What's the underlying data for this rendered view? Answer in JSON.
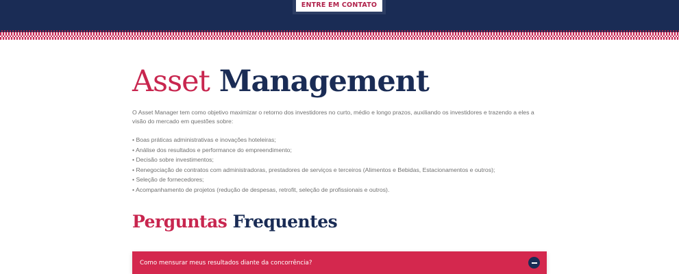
{
  "header": {
    "cta_label": "ENTRE EM CONTATO"
  },
  "main": {
    "title_light": "Asset",
    "title_bold": "Management",
    "intro": "O Asset Manager tem como objetivo maximizar o retorno dos investidores no curto, médio e longo prazos, auxiliando os investidores e trazendo a eles a visão do mercado em questões sobre:",
    "bullets": [
      "• Boas práticas administrativas e inovações hoteleiras;",
      "• Análise dos resultados e performance do empreendimento;",
      "• Decisão sobre investimentos;",
      "• Renegociação de contratos com administradoras, prestadores de serviços e terceiros (Alimentos e Bebidas, Estacionamentos e outros);",
      "• Seleção de fornecedores;",
      "• Acompanhamento de projetos (redução de despesas, retrofit, seleção de profissionais e outros)."
    ]
  },
  "faq": {
    "title_light": "Perguntas",
    "title_bold": "Frequentes",
    "items": [
      {
        "question": "Como mensurar meus resultados diante da concorrência?",
        "icon": "minus-circle-icon"
      }
    ]
  },
  "colors": {
    "navy": "#1a2c55",
    "crimson": "#c8264f",
    "faq_bar": "#d4284e",
    "body_text": "#707070"
  }
}
